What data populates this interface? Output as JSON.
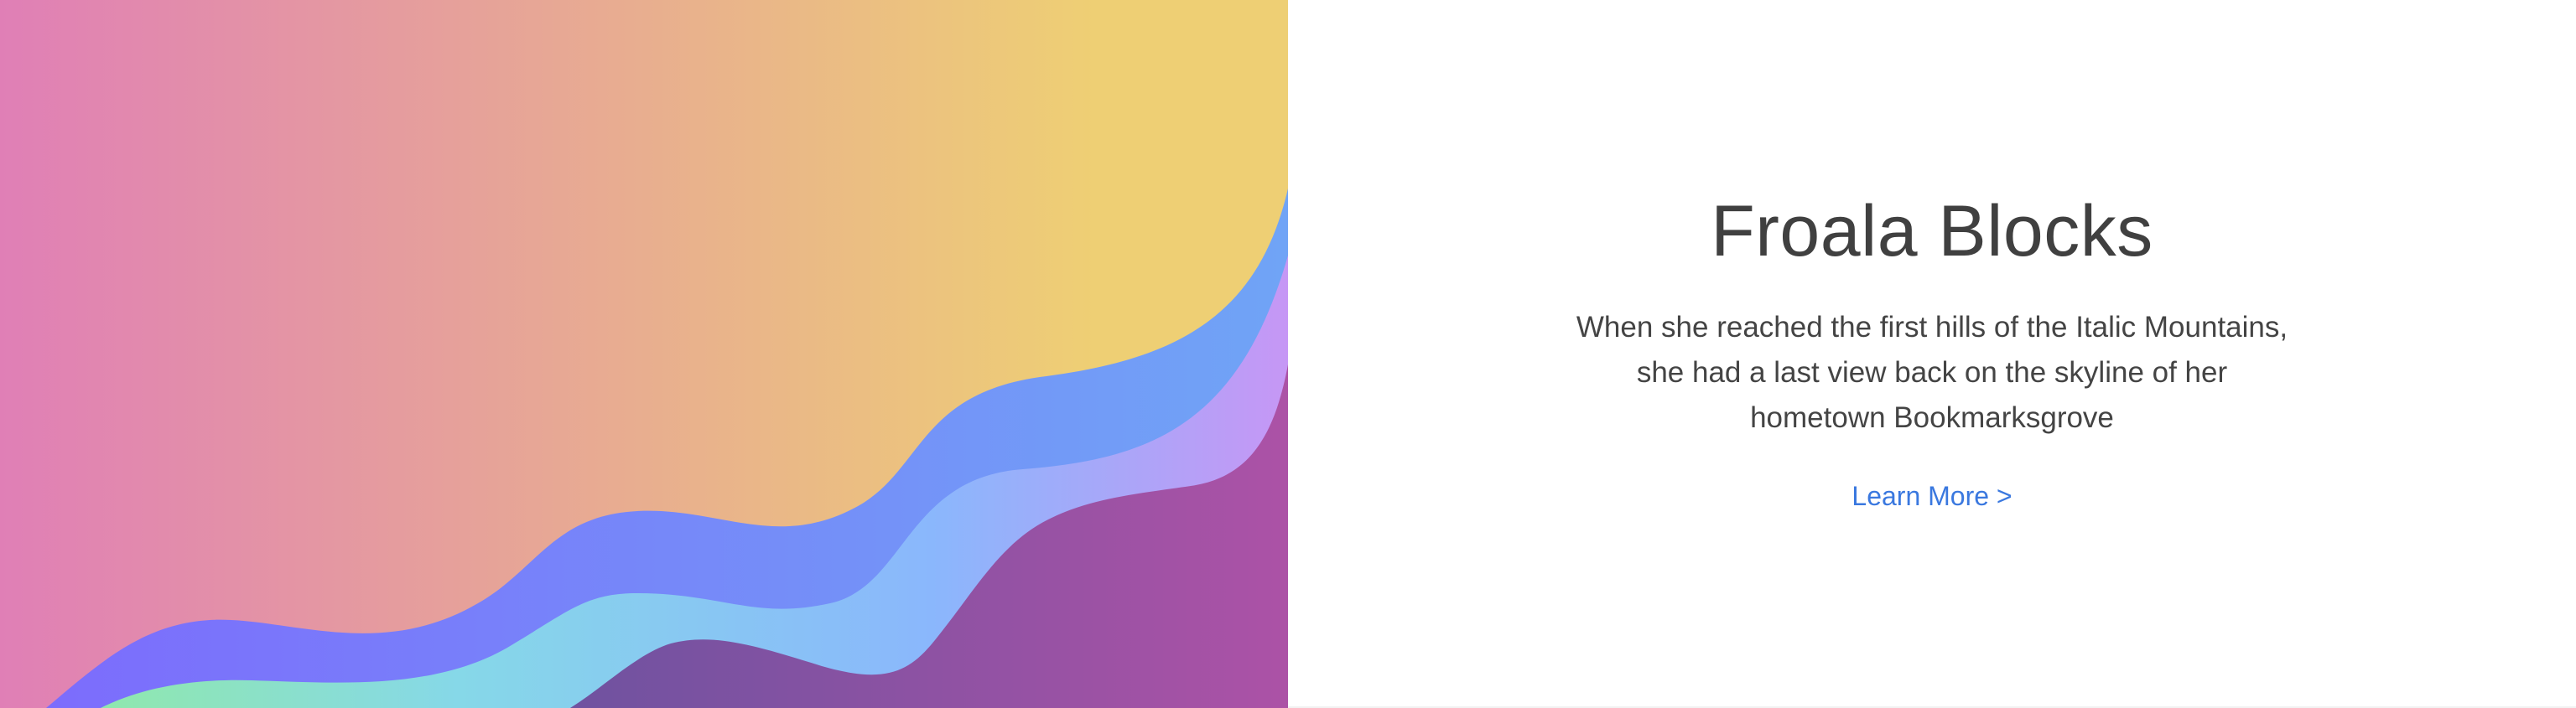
{
  "hero": {
    "title": "Froala Blocks",
    "description_lines": [
      "When she reached the first hills of the Italic Mountains,",
      "she had a last view back on the skyline of her",
      "hometown Bookmarksgrove"
    ],
    "link_label": "Learn More >"
  },
  "illustration": {
    "icon": "abstract-waves-illustration",
    "colors": {
      "background_left": "#e07fb6",
      "background_right": "#eecf74",
      "wave_blue_left": "#7c6cfc",
      "wave_blue_right": "#70a4f6",
      "wave_teal_left": "#8fe8ad",
      "wave_teal_right": "#c697f5",
      "wave_purple_left": "#6f52a0",
      "wave_purple_right": "#ac52a6"
    }
  },
  "colors": {
    "title": "#404040",
    "text": "#444444",
    "link": "#3a78df"
  }
}
